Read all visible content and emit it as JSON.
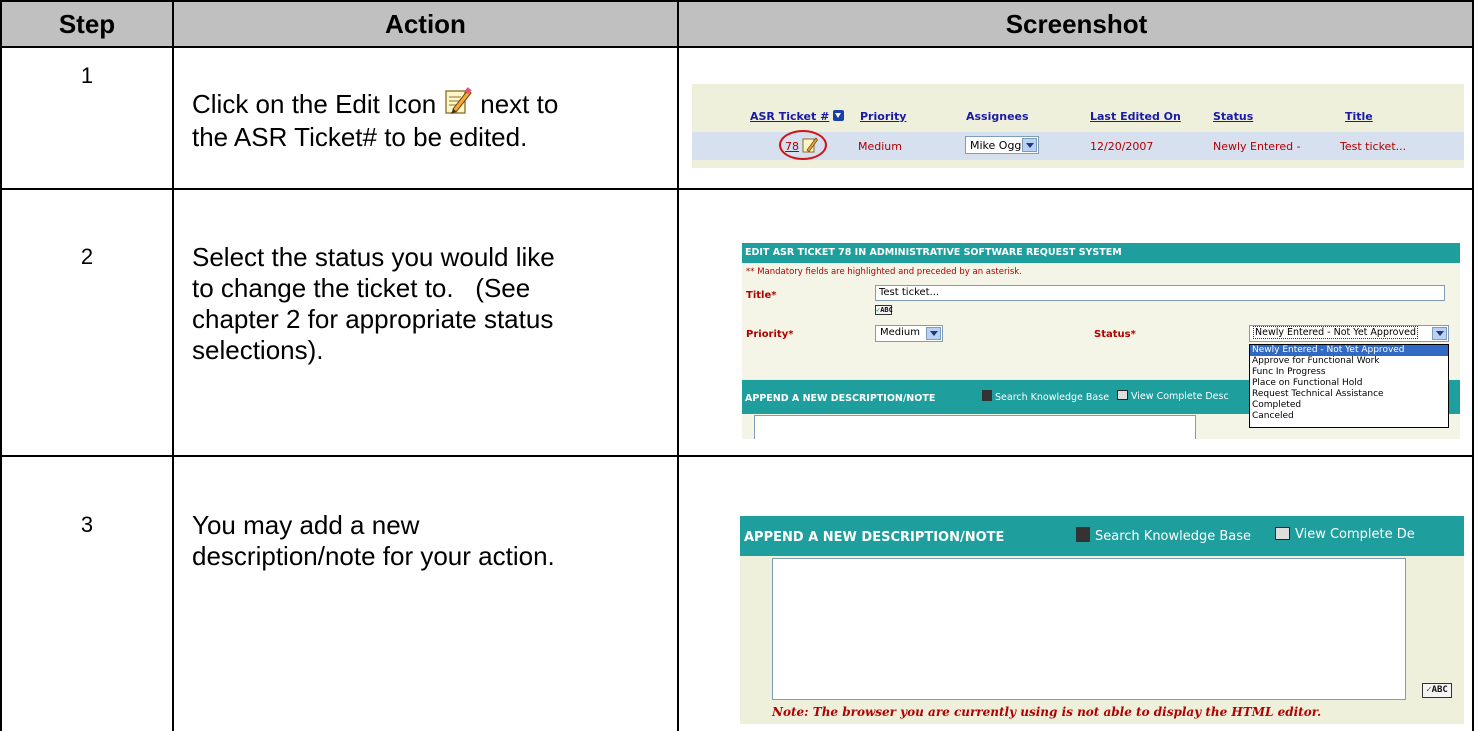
{
  "table": {
    "headers": {
      "step": "Step",
      "action": "Action",
      "screenshot": "Screenshot"
    },
    "rows": [
      {
        "step": "1",
        "action_before_icon": "Click on the Edit Icon",
        "action_after_icon": "next to",
        "action_line2": "the ASR Ticket# to be edited."
      },
      {
        "step": "2",
        "action_lines": [
          "Select the status you would like",
          "to change the ticket to.   (See",
          "chapter 2 for appropriate status",
          "selections)."
        ]
      },
      {
        "step": "3",
        "action_lines": [
          "You may add a new",
          "description/note for your action."
        ]
      }
    ]
  },
  "shot1": {
    "columns": [
      "ASR Ticket #",
      "Priority",
      "Assignees",
      "Last Edited On",
      "Status",
      "Title"
    ],
    "row": {
      "ticket": "78",
      "priority": "Medium",
      "assignee": "Mike Ogg",
      "last_edited": "12/20/2007",
      "status": "Newly Entered -",
      "title": "Test ticket..."
    }
  },
  "shot2": {
    "header": "EDIT ASR TICKET 78 IN ADMINISTRATIVE SOFTWARE REQUEST SYSTEM",
    "mandatory_note": "** Mandatory fields are highlighted and preceded by an asterisk.",
    "title_label": "Title*",
    "title_value": "Test ticket...",
    "spell_label": "ABC",
    "priority_label": "Priority*",
    "priority_value": "Medium",
    "status_label": "Status*",
    "status_value": "Newly Entered - Not Yet Approved",
    "status_options": [
      "Newly Entered - Not Yet Approved",
      "Approve for Functional Work",
      "Func In Progress",
      "Place on Functional Hold",
      "Request Technical Assistance",
      "Completed",
      "Canceled"
    ],
    "append_header": "APPEND A NEW DESCRIPTION/NOTE",
    "search_kb": "Search Knowledge Base",
    "view_complete": "View Complete Desc"
  },
  "shot3": {
    "append_header": "APPEND A NEW DESCRIPTION/NOTE",
    "search_kb": "Search Knowledge Base",
    "view_complete": "View Complete De",
    "spell_label": "ABC",
    "note": "Note: The browser you are currently using is not able to display the HTML editor."
  },
  "colors": {
    "header_bg": "#c0c0c0",
    "teal": "#1f9e9e",
    "panel": "#eef0dc",
    "highlight": "#316ac5",
    "error_red": "#b00000"
  }
}
